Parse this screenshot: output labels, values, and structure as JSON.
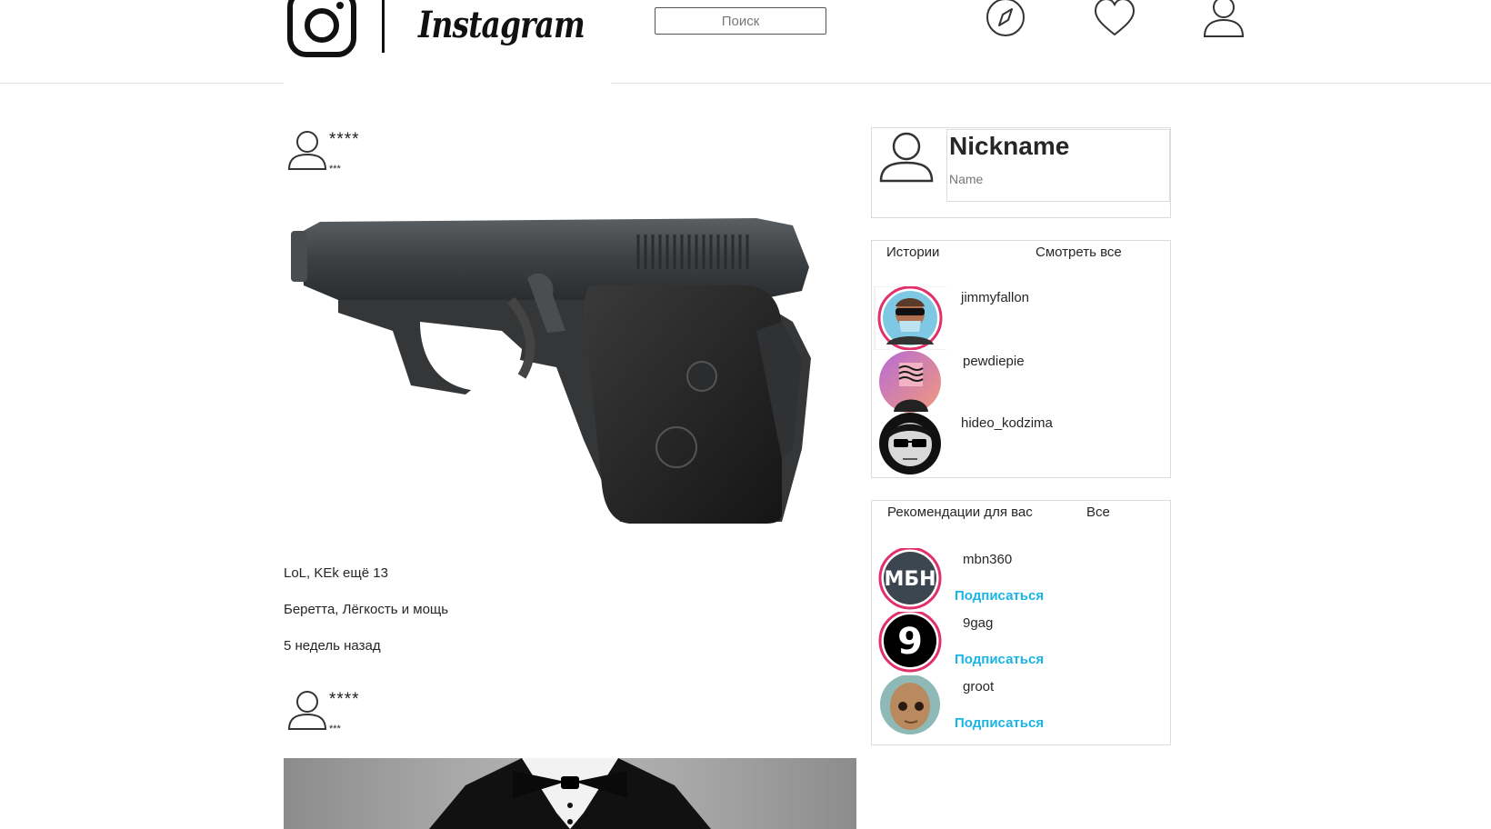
{
  "header": {
    "logo_text": "Instagram",
    "search_placeholder": "Поиск",
    "nav_icons": [
      "compass-icon",
      "heart-icon",
      "user-icon"
    ]
  },
  "feed": {
    "posts": [
      {
        "username": "****",
        "subtitle": "***",
        "image": "pistol-photo",
        "likes_text": "LoL, KEk ещё 13",
        "caption": "Беретта, Лёгкость и мощь",
        "time": "5 недель назад"
      },
      {
        "username": "****",
        "subtitle": "***",
        "image": "tuxedo-photo"
      }
    ]
  },
  "sidebar": {
    "profile": {
      "nickname": "Nickname",
      "name": "Name"
    },
    "stories": {
      "title": "Истории",
      "see_all": "Смотреть все",
      "items": [
        {
          "username": "jimmyfallon"
        },
        {
          "username": "pewdiepie"
        },
        {
          "username": "hideo_kodzima"
        }
      ]
    },
    "recommendations": {
      "title": "Рекомендации для вас",
      "all": "Все",
      "follow_label": "Подписаться",
      "items": [
        {
          "username": "mbn360",
          "avatar_text": "МБН"
        },
        {
          "username": "9gag",
          "avatar_text": "9"
        },
        {
          "username": "groot"
        }
      ]
    }
  },
  "colors": {
    "follow": "#1ab4e6",
    "border": "#dcdcdc",
    "story_ring": "#e1306c"
  }
}
